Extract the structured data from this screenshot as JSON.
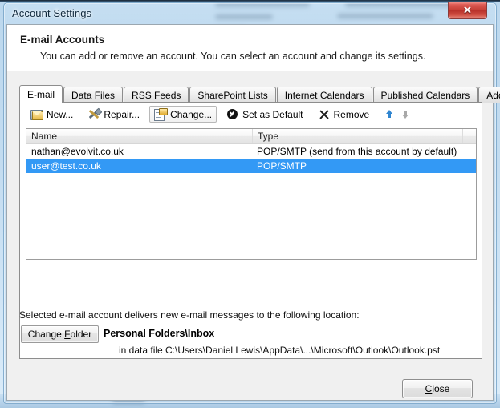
{
  "window": {
    "title": "Account Settings",
    "close_button": {
      "name": "close-window",
      "glyph": "✕"
    }
  },
  "header": {
    "title": "E-mail Accounts",
    "subtitle": "You can add or remove an account. You can select an account and change its settings."
  },
  "tabs": [
    {
      "label": "E-mail",
      "active": true
    },
    {
      "label": "Data Files",
      "active": false
    },
    {
      "label": "RSS Feeds",
      "active": false
    },
    {
      "label": "SharePoint Lists",
      "active": false
    },
    {
      "label": "Internet Calendars",
      "active": false
    },
    {
      "label": "Published Calendars",
      "active": false
    },
    {
      "label": "Address Books",
      "active": false
    }
  ],
  "toolbar": {
    "new_label": "New...",
    "repair_label": "Repair...",
    "change_label": "Change...",
    "set_default_label": "Set as Default",
    "remove_label": "Remove",
    "move_up_label": "Move Up",
    "move_down_label": "Move Down"
  },
  "accounts_list": {
    "columns": [
      "Name",
      "Type"
    ],
    "rows": [
      {
        "name": "nathan@evolvit.co.uk",
        "type": "POP/SMTP (send from this account by default)",
        "selected": false
      },
      {
        "name": "user@test.co.uk",
        "type": "POP/SMTP",
        "selected": true
      }
    ]
  },
  "delivery": {
    "label": "Selected e-mail account delivers new e-mail messages to the following location:",
    "change_folder_label": "Change Folder",
    "folder_name": "Personal Folders\\Inbox",
    "data_file_path": "in data file C:\\Users\\Daniel Lewis\\AppData\\...\\Microsoft\\Outlook\\Outlook.pst"
  },
  "footer": {
    "close_label": "Close"
  },
  "colors": {
    "selection_blue": "#3399f5",
    "close_button_red": "#c43e35",
    "dialog_gray": "#f0f0f0",
    "arrow_enabled": "#2f85d0",
    "arrow_disabled": "#a8a8a8"
  }
}
